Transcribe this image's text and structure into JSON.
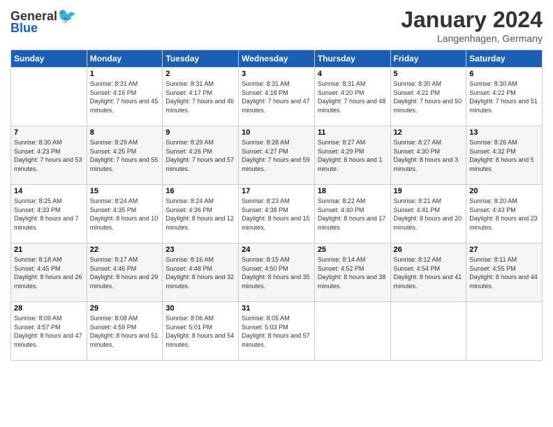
{
  "header": {
    "logo_general": "General",
    "logo_blue": "Blue",
    "month_year": "January 2024",
    "location": "Langenhagen, Germany"
  },
  "days_of_week": [
    "Sunday",
    "Monday",
    "Tuesday",
    "Wednesday",
    "Thursday",
    "Friday",
    "Saturday"
  ],
  "weeks": [
    [
      {
        "day": "",
        "sunrise": "",
        "sunset": "",
        "daylight": ""
      },
      {
        "day": "1",
        "sunrise": "Sunrise: 8:31 AM",
        "sunset": "Sunset: 4:16 PM",
        "daylight": "Daylight: 7 hours and 45 minutes."
      },
      {
        "day": "2",
        "sunrise": "Sunrise: 8:31 AM",
        "sunset": "Sunset: 4:17 PM",
        "daylight": "Daylight: 7 hours and 46 minutes."
      },
      {
        "day": "3",
        "sunrise": "Sunrise: 8:31 AM",
        "sunset": "Sunset: 4:18 PM",
        "daylight": "Daylight: 7 hours and 47 minutes."
      },
      {
        "day": "4",
        "sunrise": "Sunrise: 8:31 AM",
        "sunset": "Sunset: 4:20 PM",
        "daylight": "Daylight: 7 hours and 48 minutes."
      },
      {
        "day": "5",
        "sunrise": "Sunrise: 8:30 AM",
        "sunset": "Sunset: 4:21 PM",
        "daylight": "Daylight: 7 hours and 50 minutes."
      },
      {
        "day": "6",
        "sunrise": "Sunrise: 8:30 AM",
        "sunset": "Sunset: 4:22 PM",
        "daylight": "Daylight: 7 hours and 51 minutes."
      }
    ],
    [
      {
        "day": "7",
        "sunrise": "Sunrise: 8:30 AM",
        "sunset": "Sunset: 4:23 PM",
        "daylight": "Daylight: 7 hours and 53 minutes."
      },
      {
        "day": "8",
        "sunrise": "Sunrise: 8:29 AM",
        "sunset": "Sunset: 4:25 PM",
        "daylight": "Daylight: 7 hours and 55 minutes."
      },
      {
        "day": "9",
        "sunrise": "Sunrise: 8:29 AM",
        "sunset": "Sunset: 4:26 PM",
        "daylight": "Daylight: 7 hours and 57 minutes."
      },
      {
        "day": "10",
        "sunrise": "Sunrise: 8:28 AM",
        "sunset": "Sunset: 4:27 PM",
        "daylight": "Daylight: 7 hours and 59 minutes."
      },
      {
        "day": "11",
        "sunrise": "Sunrise: 8:27 AM",
        "sunset": "Sunset: 4:29 PM",
        "daylight": "Daylight: 8 hours and 1 minute."
      },
      {
        "day": "12",
        "sunrise": "Sunrise: 8:27 AM",
        "sunset": "Sunset: 4:30 PM",
        "daylight": "Daylight: 8 hours and 3 minutes."
      },
      {
        "day": "13",
        "sunrise": "Sunrise: 8:26 AM",
        "sunset": "Sunset: 4:32 PM",
        "daylight": "Daylight: 8 hours and 5 minutes."
      }
    ],
    [
      {
        "day": "14",
        "sunrise": "Sunrise: 8:25 AM",
        "sunset": "Sunset: 4:33 PM",
        "daylight": "Daylight: 8 hours and 7 minutes."
      },
      {
        "day": "15",
        "sunrise": "Sunrise: 8:24 AM",
        "sunset": "Sunset: 4:35 PM",
        "daylight": "Daylight: 8 hours and 10 minutes."
      },
      {
        "day": "16",
        "sunrise": "Sunrise: 8:24 AM",
        "sunset": "Sunset: 4:36 PM",
        "daylight": "Daylight: 8 hours and 12 minutes."
      },
      {
        "day": "17",
        "sunrise": "Sunrise: 8:23 AM",
        "sunset": "Sunset: 4:38 PM",
        "daylight": "Daylight: 8 hours and 15 minutes."
      },
      {
        "day": "18",
        "sunrise": "Sunrise: 8:22 AM",
        "sunset": "Sunset: 4:40 PM",
        "daylight": "Daylight: 8 hours and 17 minutes."
      },
      {
        "day": "19",
        "sunrise": "Sunrise: 8:21 AM",
        "sunset": "Sunset: 4:41 PM",
        "daylight": "Daylight: 8 hours and 20 minutes."
      },
      {
        "day": "20",
        "sunrise": "Sunrise: 8:20 AM",
        "sunset": "Sunset: 4:43 PM",
        "daylight": "Daylight: 8 hours and 23 minutes."
      }
    ],
    [
      {
        "day": "21",
        "sunrise": "Sunrise: 8:18 AM",
        "sunset": "Sunset: 4:45 PM",
        "daylight": "Daylight: 8 hours and 26 minutes."
      },
      {
        "day": "22",
        "sunrise": "Sunrise: 8:17 AM",
        "sunset": "Sunset: 4:46 PM",
        "daylight": "Daylight: 8 hours and 29 minutes."
      },
      {
        "day": "23",
        "sunrise": "Sunrise: 8:16 AM",
        "sunset": "Sunset: 4:48 PM",
        "daylight": "Daylight: 8 hours and 32 minutes."
      },
      {
        "day": "24",
        "sunrise": "Sunrise: 8:15 AM",
        "sunset": "Sunset: 4:50 PM",
        "daylight": "Daylight: 8 hours and 35 minutes."
      },
      {
        "day": "25",
        "sunrise": "Sunrise: 8:14 AM",
        "sunset": "Sunset: 4:52 PM",
        "daylight": "Daylight: 8 hours and 38 minutes."
      },
      {
        "day": "26",
        "sunrise": "Sunrise: 8:12 AM",
        "sunset": "Sunset: 4:54 PM",
        "daylight": "Daylight: 8 hours and 41 minutes."
      },
      {
        "day": "27",
        "sunrise": "Sunrise: 8:11 AM",
        "sunset": "Sunset: 4:55 PM",
        "daylight": "Daylight: 8 hours and 44 minutes."
      }
    ],
    [
      {
        "day": "28",
        "sunrise": "Sunrise: 8:09 AM",
        "sunset": "Sunset: 4:57 PM",
        "daylight": "Daylight: 8 hours and 47 minutes."
      },
      {
        "day": "29",
        "sunrise": "Sunrise: 8:08 AM",
        "sunset": "Sunset: 4:59 PM",
        "daylight": "Daylight: 8 hours and 51 minutes."
      },
      {
        "day": "30",
        "sunrise": "Sunrise: 8:06 AM",
        "sunset": "Sunset: 5:01 PM",
        "daylight": "Daylight: 8 hours and 54 minutes."
      },
      {
        "day": "31",
        "sunrise": "Sunrise: 8:05 AM",
        "sunset": "Sunset: 5:03 PM",
        "daylight": "Daylight: 8 hours and 57 minutes."
      },
      {
        "day": "",
        "sunrise": "",
        "sunset": "",
        "daylight": ""
      },
      {
        "day": "",
        "sunrise": "",
        "sunset": "",
        "daylight": ""
      },
      {
        "day": "",
        "sunrise": "",
        "sunset": "",
        "daylight": ""
      }
    ]
  ]
}
